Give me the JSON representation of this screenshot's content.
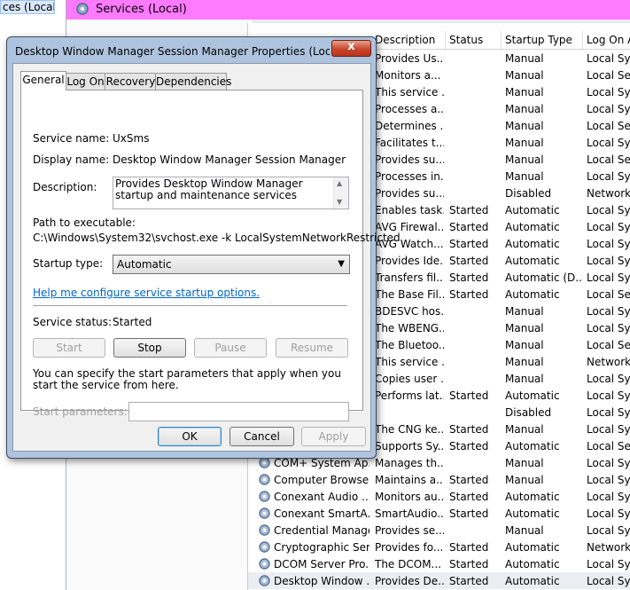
{
  "left_tree": {
    "item_label": "ces (Local)"
  },
  "header": {
    "title": "Services (Local)",
    "icon": "gear-icon",
    "color": "#ff7aff"
  },
  "services": {
    "columns": {
      "description": "Description",
      "status": "Status",
      "startup_type": "Startup Type",
      "log_on_as": "Log On A"
    },
    "rows": [
      {
        "name": "",
        "description": "Provides Us...",
        "status": "",
        "startup_type": "Manual",
        "log_on_as": "Local Syst"
      },
      {
        "name": "",
        "description": "Monitors a...",
        "status": "",
        "startup_type": "Manual",
        "log_on_as": "Local Serv"
      },
      {
        "name": "",
        "description": "This service ...",
        "status": "",
        "startup_type": "Manual",
        "log_on_as": "Local Syst"
      },
      {
        "name": "",
        "description": "Processes a...",
        "status": "",
        "startup_type": "Manual",
        "log_on_as": "Local Syst"
      },
      {
        "name": "",
        "description": "Determines ...",
        "status": "",
        "startup_type": "Manual",
        "log_on_as": "Local Serv"
      },
      {
        "name": "",
        "description": "Facilitates t...",
        "status": "",
        "startup_type": "Manual",
        "log_on_as": "Local Syst"
      },
      {
        "name": "",
        "description": "Provides su...",
        "status": "",
        "startup_type": "Manual",
        "log_on_as": "Local Serv"
      },
      {
        "name": "",
        "description": "Processes in...",
        "status": "",
        "startup_type": "Manual",
        "log_on_as": "Local Syst"
      },
      {
        "name": "",
        "description": "Provides su...",
        "status": "",
        "startup_type": "Disabled",
        "log_on_as": "Network S"
      },
      {
        "name": "",
        "description": "Enables task...",
        "status": "Started",
        "startup_type": "Automatic",
        "log_on_as": "Local Syst"
      },
      {
        "name": "",
        "description": "AVG Firewal...",
        "status": "Started",
        "startup_type": "Automatic",
        "log_on_as": "Local Syst"
      },
      {
        "name": "",
        "description": "AVG Watch...",
        "status": "Started",
        "startup_type": "Automatic",
        "log_on_as": "Local Syst"
      },
      {
        "name": "",
        "description": "Provides Ide...",
        "status": "Started",
        "startup_type": "Automatic",
        "log_on_as": "Local Syst"
      },
      {
        "name": "",
        "description": "Transfers fil...",
        "status": "Started",
        "startup_type": "Automatic (D...",
        "log_on_as": "Local Syst"
      },
      {
        "name": "",
        "description": "The Base Fil...",
        "status": "Started",
        "startup_type": "Automatic",
        "log_on_as": "Local Serv"
      },
      {
        "name": "",
        "description": "BDESVC hos...",
        "status": "",
        "startup_type": "Manual",
        "log_on_as": "Local Syst"
      },
      {
        "name": "",
        "description": "The WBENG...",
        "status": "",
        "startup_type": "Manual",
        "log_on_as": "Local Syst"
      },
      {
        "name": "",
        "description": "The Bluetoo...",
        "status": "",
        "startup_type": "Manual",
        "log_on_as": "Local Serv"
      },
      {
        "name": "",
        "description": "This service ...",
        "status": "",
        "startup_type": "Manual",
        "log_on_as": "Network S"
      },
      {
        "name": "",
        "description": "Copies user ...",
        "status": "",
        "startup_type": "Manual",
        "log_on_as": "Local Syst"
      },
      {
        "name": "",
        "description": "Performs lat...",
        "status": "Started",
        "startup_type": "Automatic",
        "log_on_as": "Local Syst"
      },
      {
        "name": "",
        "description": "",
        "status": "",
        "startup_type": "Disabled",
        "log_on_as": "Local Syst"
      },
      {
        "name": "",
        "description": "The CNG ke...",
        "status": "Started",
        "startup_type": "Manual",
        "log_on_as": "Local Syst"
      },
      {
        "name": "",
        "description": "Supports Sy...",
        "status": "Started",
        "startup_type": "Automatic",
        "log_on_as": "Local Serv"
      },
      {
        "name": "COM+ System Ap...",
        "description": "Manages th...",
        "status": "",
        "startup_type": "Manual",
        "log_on_as": "Local Syst"
      },
      {
        "name": "Computer Browser",
        "description": "Maintains a...",
        "status": "Started",
        "startup_type": "Manual",
        "log_on_as": "Local Syst"
      },
      {
        "name": "Conexant Audio ...",
        "description": "Monitors au...",
        "status": "Started",
        "startup_type": "Automatic",
        "log_on_as": "Local Syst"
      },
      {
        "name": "Conexant SmartA...",
        "description": "SmartAudio...",
        "status": "Started",
        "startup_type": "Automatic",
        "log_on_as": "Local Syst"
      },
      {
        "name": "Credential Manager",
        "description": "Provides se...",
        "status": "",
        "startup_type": "Manual",
        "log_on_as": "Local Syst"
      },
      {
        "name": "Cryptographic Ser...",
        "description": "Provides fo...",
        "status": "Started",
        "startup_type": "Automatic",
        "log_on_as": "Network S"
      },
      {
        "name": "DCOM Server Pro...",
        "description": "The DCOM...",
        "status": "Started",
        "startup_type": "Automatic",
        "log_on_as": "Local Syst"
      },
      {
        "name": "Desktop Window ...",
        "description": "Provides De...",
        "status": "Started",
        "startup_type": "Automatic",
        "log_on_as": "Local Syst",
        "selected": true
      }
    ]
  },
  "dialog": {
    "title": "Desktop Window Manager Session Manager Properties (Local Co...",
    "close_label": "x",
    "tabs": [
      "General",
      "Log On",
      "Recovery",
      "Dependencies"
    ],
    "service_name_label": "Service name:",
    "service_name": "UxSms",
    "display_name_label": "Display name:",
    "display_name": "Desktop Window Manager Session Manager",
    "description_label": "Description:",
    "description": "Provides Desktop Window Manager startup and maintenance services",
    "path_label": "Path to executable:",
    "path": "C:\\Windows\\System32\\svchost.exe -k LocalSystemNetworkRestricted",
    "startup_type_label": "Startup type:",
    "startup_type": "Automatic",
    "help_link": "Help me configure service startup options.",
    "service_status_label": "Service status:",
    "service_status": "Started",
    "buttons": {
      "start": "Start",
      "stop": "Stop",
      "pause": "Pause",
      "resume": "Resume"
    },
    "params_hint": "You can specify the start parameters that apply when you start the service from here.",
    "start_params_label": "Start parameters:",
    "start_params_value": "",
    "footer": {
      "ok": "OK",
      "cancel": "Cancel",
      "apply": "Apply"
    }
  }
}
